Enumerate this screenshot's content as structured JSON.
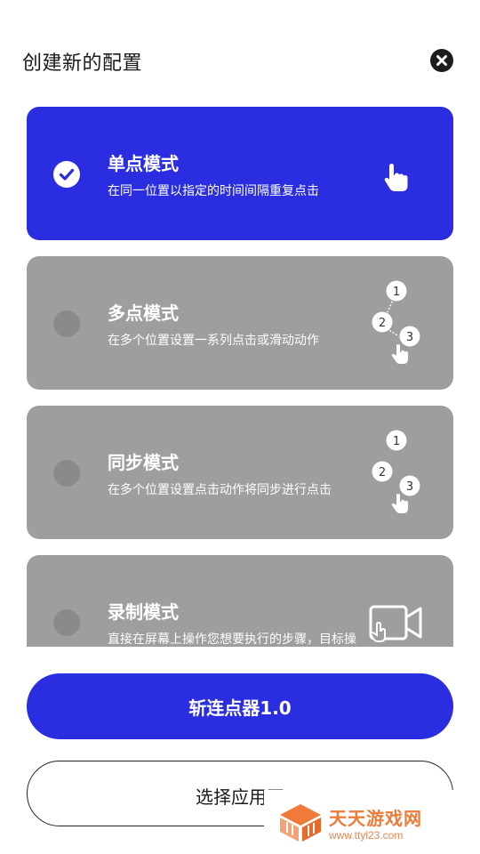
{
  "header": {
    "title": "创建新的配置"
  },
  "modes": [
    {
      "title": "单点模式",
      "description": "在同一位置以指定的时间间隔重复点击",
      "selected": true,
      "icon": "tap-hand-icon"
    },
    {
      "title": "多点模式",
      "description": "在多个位置设置一系列点击或滑动动作",
      "selected": false,
      "icon": "multi-tap-icon",
      "steps": [
        "1",
        "2",
        "3"
      ]
    },
    {
      "title": "同步模式",
      "description": "在多个位置设置点击动作将同步进行点击",
      "selected": false,
      "icon": "sync-tap-icon",
      "steps": [
        "1",
        "2",
        "3"
      ]
    },
    {
      "title": "录制模式",
      "description": "直接在屏幕上操作您想要执行的步骤，目标操作将自动添加",
      "selected": false,
      "icon": "record-video-icon"
    }
  ],
  "buttons": {
    "primary_label": "斩连点器1.0",
    "secondary_label": "选择应用开"
  },
  "watermark": {
    "title": "天天游戏网",
    "url": "www.ttyl23.com"
  },
  "colors": {
    "accent": "#2b2ee0",
    "card_inactive": "#9e9e9e",
    "watermark": "#f07a3a"
  }
}
